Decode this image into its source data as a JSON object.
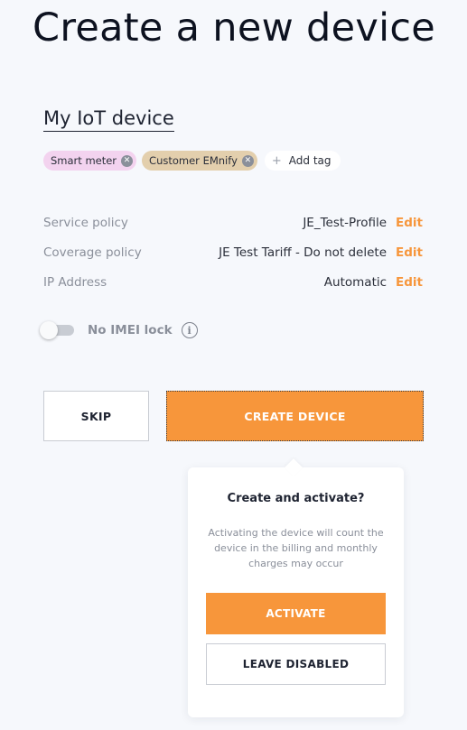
{
  "page": {
    "title": "Create a new device"
  },
  "device": {
    "name": "My IoT device"
  },
  "tags": [
    {
      "label": "Smart meter",
      "color": "#f3d3ef"
    },
    {
      "label": "Customer EMnify",
      "color": "#e3cfad"
    }
  ],
  "add_tag": {
    "label": "Add tag",
    "icon": "plus-icon"
  },
  "policies": [
    {
      "label": "Service policy",
      "value": "JE_Test-Profile",
      "action": "Edit"
    },
    {
      "label": "Coverage policy",
      "value": "JE Test Tariff - Do not delete",
      "action": "Edit"
    },
    {
      "label": "IP Address",
      "value": "Automatic",
      "action": "Edit"
    }
  ],
  "imei_lock": {
    "label": "No IMEI lock",
    "enabled": false,
    "info_icon": "info-icon"
  },
  "actions": {
    "skip_label": "SKIP",
    "create_label": "CREATE DEVICE"
  },
  "popover": {
    "title": "Create and activate?",
    "text": "Activating the device will count the device in the billing and monthly charges may occur",
    "activate_label": "ACTIVATE",
    "leave_label": "LEAVE DISABLED"
  },
  "colors": {
    "accent": "#f7963b",
    "background": "#f6f8fc",
    "muted_text": "#8a8f9a"
  }
}
